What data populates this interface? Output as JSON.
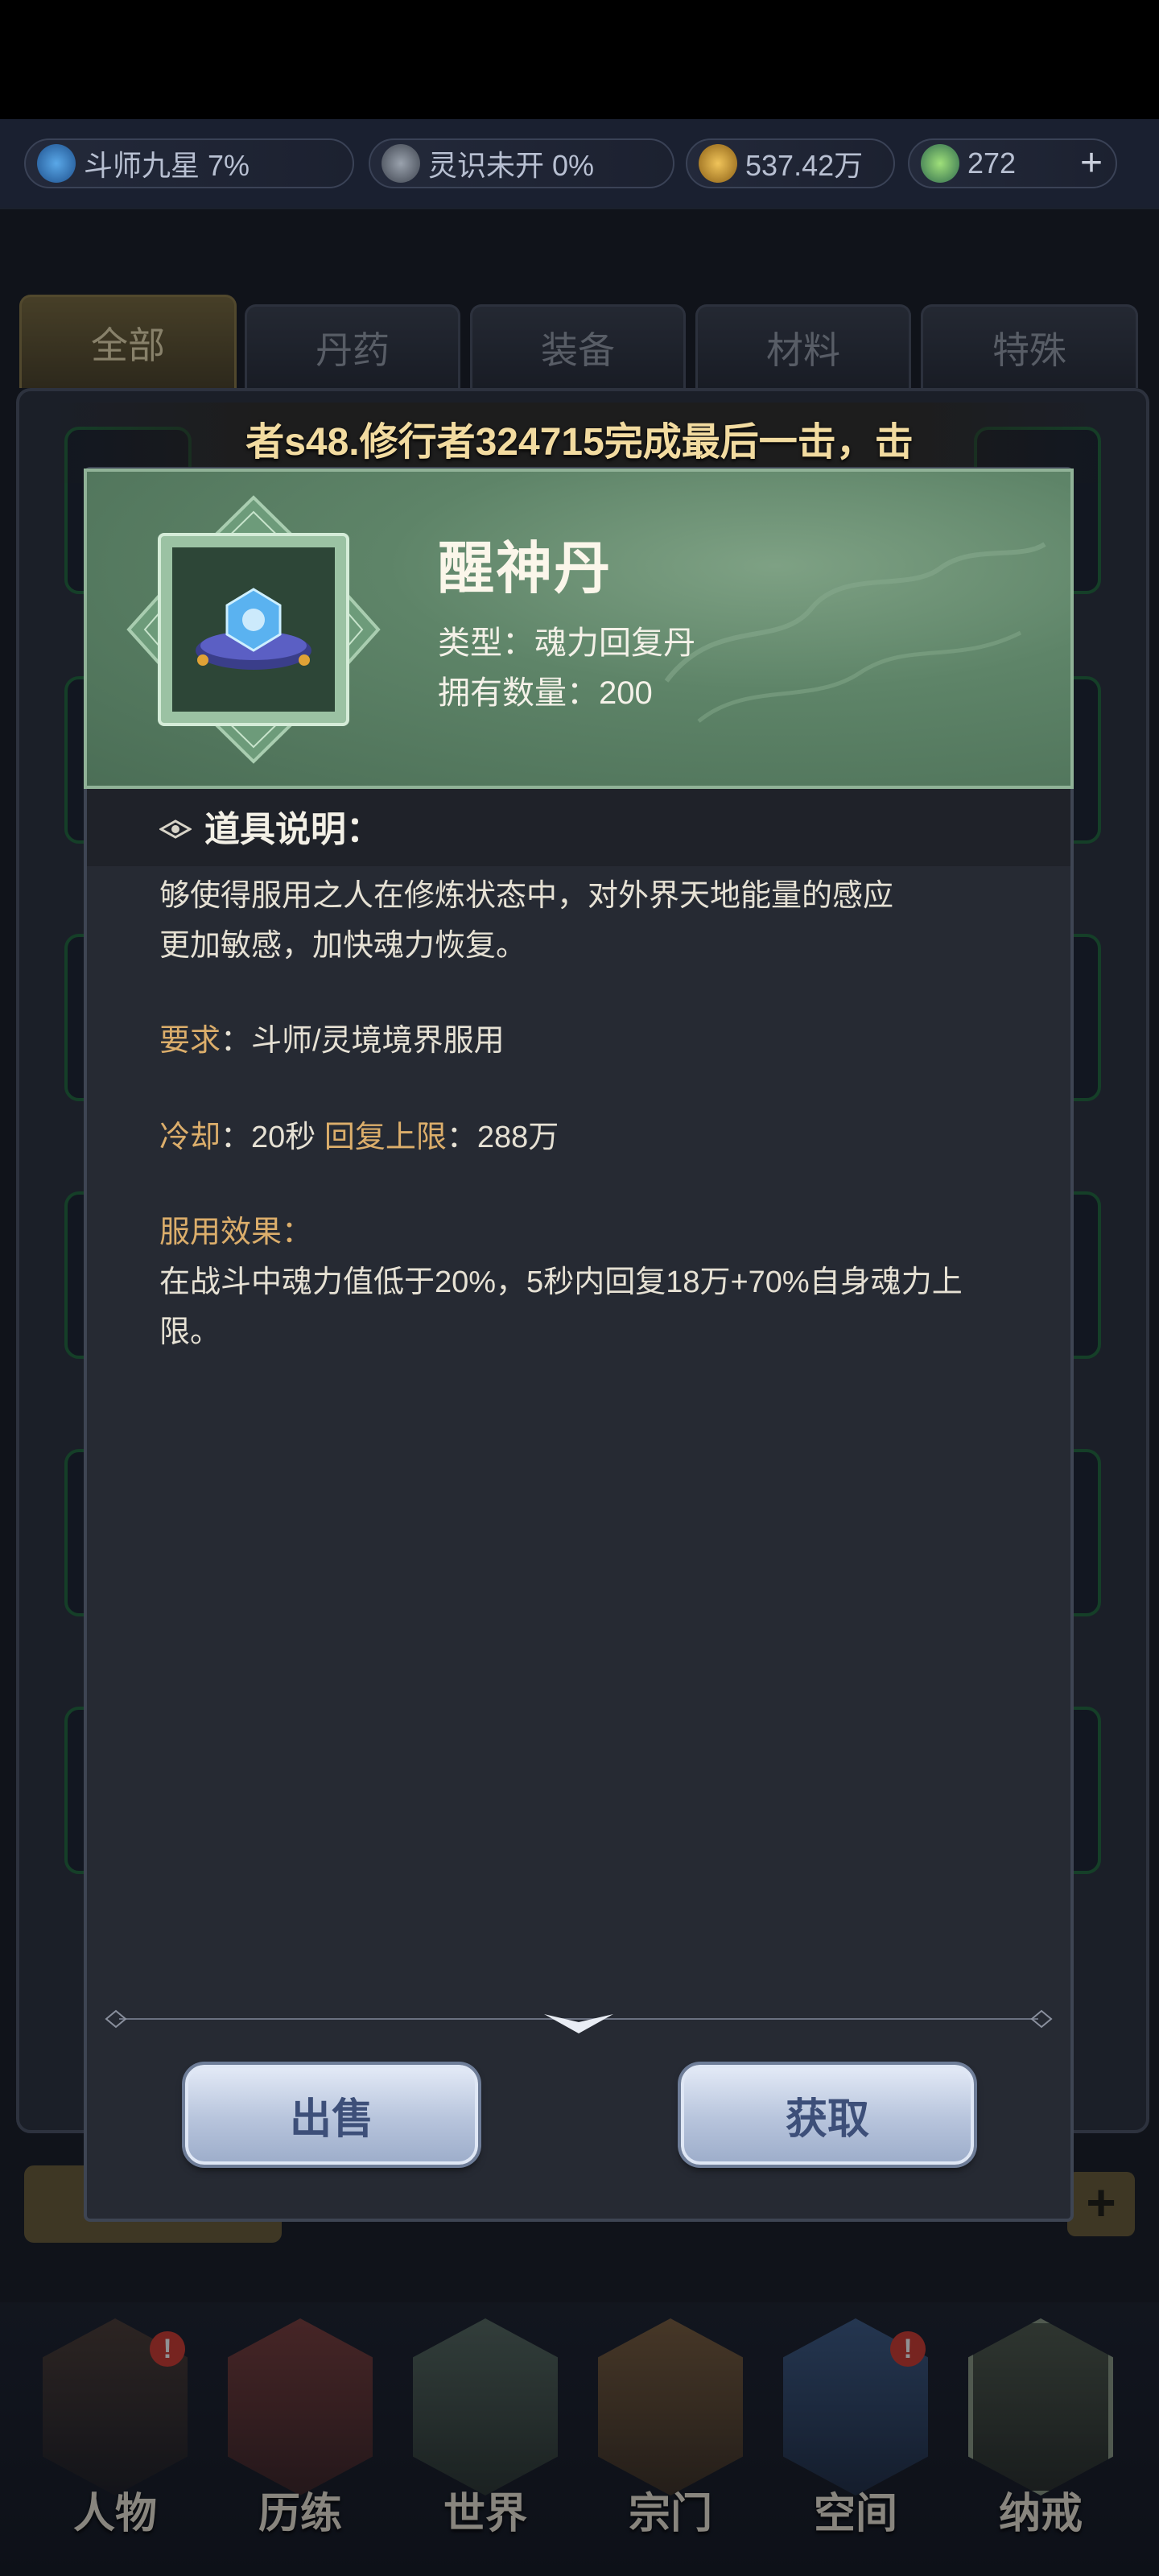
{
  "statusbar": {
    "items": [
      {
        "icon": "cultivation-flame-icon",
        "text": "斗师九星 7%"
      },
      {
        "icon": "spirit-swirl-icon",
        "text": "灵识未开 0%"
      },
      {
        "icon": "gold-coin-icon",
        "text": "537.42万"
      },
      {
        "icon": "jade-gem-icon",
        "text": "272"
      }
    ],
    "plus_label": "+"
  },
  "tabs": [
    {
      "label": "全部",
      "active": true
    },
    {
      "label": "丹药",
      "active": false
    },
    {
      "label": "装备",
      "active": false
    },
    {
      "label": "材料",
      "active": false
    },
    {
      "label": "特殊",
      "active": false
    }
  ],
  "ticker": "者s48.修行者324715完成最后一击，击",
  "item": {
    "name": "醒神丹",
    "type_line": "类型：魂力回复丹",
    "count_line": "拥有数量：200",
    "icon": "soul-pill-on-cushion-icon"
  },
  "description": {
    "title": "道具说明：",
    "body_line1": "够使得服用之人在修炼状态中，对外界天地能量的感应",
    "body_line2": "更加敏感，加快魂力恢复。",
    "req_label": "要求",
    "req_value": "：斗师/灵境境界服用",
    "cd_label": "冷却",
    "cd_value": "：20秒 ",
    "cap_label": "回复上限",
    "cap_value": "：288万",
    "effect_label": "服用效果",
    "effect_colon": "：",
    "effect_line1": "在战斗中魂力值低于20%，5秒内回复18万+70%自身魂力上",
    "effect_line2": "限。"
  },
  "buttons": {
    "sell": "出售",
    "obtain": "获取"
  },
  "bottom_nav": [
    {
      "label": "人物",
      "badge": "!"
    },
    {
      "label": "历练",
      "badge": ""
    },
    {
      "label": "世界",
      "badge": ""
    },
    {
      "label": "宗门",
      "badge": ""
    },
    {
      "label": "空间",
      "badge": "!"
    },
    {
      "label": "纳戒",
      "badge": ""
    }
  ],
  "colors": {
    "header_green": "#5e8468",
    "label_gold": "#dcae6b",
    "button_text": "#3d4f79"
  }
}
